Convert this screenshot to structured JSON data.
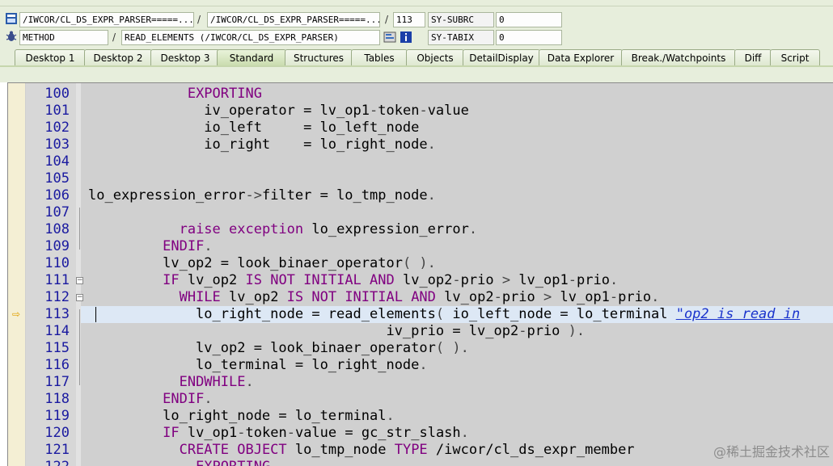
{
  "header": {
    "row1": {
      "program": "/IWCOR/CL_DS_EXPR_PARSER=====...",
      "include": "/IWCOR/CL_DS_EXPR_PARSER=====...",
      "line": "113",
      "sysfield": "SY-SUBRC",
      "sysvalue": "0",
      "separator": "/"
    },
    "row2": {
      "event_type": "METHOD",
      "event": "READ_ELEMENTS (/IWCOR/CL_DS_EXPR_PARSER)",
      "sysfield": "SY-TABIX",
      "sysvalue": "0",
      "separator": "/"
    }
  },
  "tabs": [
    {
      "label": "Desktop 1"
    },
    {
      "label": "Desktop 2"
    },
    {
      "label": "Desktop 3"
    },
    {
      "label": "Standard",
      "active": true
    },
    {
      "label": "Structures"
    },
    {
      "label": "Tables"
    },
    {
      "label": "Objects"
    },
    {
      "label": "DetailDisplay"
    },
    {
      "label": "Data Explorer"
    },
    {
      "label": "Break./Watchpoints"
    },
    {
      "label": "Diff"
    },
    {
      "label": "Script"
    }
  ],
  "code": {
    "current_line": "113",
    "lines": [
      {
        "n": "100",
        "segs": [
          [
            "            ",
            ""
          ],
          [
            "EXPORTING",
            "kw"
          ]
        ]
      },
      {
        "n": "101",
        "segs": [
          [
            "              iv_operator = lv_op1",
            ""
          ],
          [
            "-",
            "op"
          ],
          [
            "token",
            ""
          ],
          [
            "-",
            "op"
          ],
          [
            "value",
            ""
          ]
        ]
      },
      {
        "n": "102",
        "segs": [
          [
            "              io_left     = lo_left_node",
            ""
          ]
        ]
      },
      {
        "n": "103",
        "segs": [
          [
            "              io_right    = lo_right_node",
            ""
          ],
          [
            ".",
            "op"
          ]
        ]
      },
      {
        "n": "104",
        "segs": []
      },
      {
        "n": "105",
        "segs": []
      },
      {
        "n": "106",
        "segs": [
          [
            "lo_expression_error",
            ""
          ],
          [
            "->",
            "op"
          ],
          [
            "filter = lo_tmp_node",
            ""
          ],
          [
            ".",
            "op"
          ]
        ]
      },
      {
        "n": "107",
        "segs": []
      },
      {
        "n": "108",
        "segs": [
          [
            "           ",
            ""
          ],
          [
            "raise exception",
            "kw"
          ],
          [
            " lo_expression_error",
            ""
          ],
          [
            ".",
            "op"
          ]
        ]
      },
      {
        "n": "109",
        "segs": [
          [
            "         ",
            ""
          ],
          [
            "ENDIF",
            "kw"
          ],
          [
            ".",
            "op"
          ]
        ]
      },
      {
        "n": "110",
        "segs": [
          [
            "         lv_op2 = look_binaer_operator",
            ""
          ],
          [
            "( ).",
            "op"
          ]
        ]
      },
      {
        "n": "111",
        "segs": [
          [
            "         ",
            ""
          ],
          [
            "IF",
            "kw"
          ],
          [
            " lv_op2 ",
            ""
          ],
          [
            "IS NOT INITIAL AND",
            "kw"
          ],
          [
            " lv_op2",
            ""
          ],
          [
            "-",
            "op"
          ],
          [
            "prio ",
            ""
          ],
          [
            ">",
            "op"
          ],
          [
            " lv_op1",
            ""
          ],
          [
            "-",
            "op"
          ],
          [
            "prio",
            ""
          ],
          [
            ".",
            "op"
          ]
        ]
      },
      {
        "n": "112",
        "segs": [
          [
            "           ",
            ""
          ],
          [
            "WHILE",
            "kw"
          ],
          [
            " lv_op2 ",
            ""
          ],
          [
            "IS NOT INITIAL AND",
            "kw"
          ],
          [
            " lv_op2",
            ""
          ],
          [
            "-",
            "op"
          ],
          [
            "prio ",
            ""
          ],
          [
            ">",
            "op"
          ],
          [
            " lv_op1",
            ""
          ],
          [
            "-",
            "op"
          ],
          [
            "prio",
            ""
          ],
          [
            ".",
            "op"
          ]
        ]
      },
      {
        "n": "113",
        "segs": [
          [
            "             lo_right_node = read_elements",
            ""
          ],
          [
            "(",
            "op"
          ],
          [
            " io_left_node = lo_terminal ",
            ""
          ],
          [
            "\"op2 is read in",
            "cm"
          ]
        ]
      },
      {
        "n": "114",
        "segs": [
          [
            "                                    iv_prio = lv_op2",
            ""
          ],
          [
            "-",
            "op"
          ],
          [
            "prio ",
            ""
          ],
          [
            ").",
            "op"
          ]
        ]
      },
      {
        "n": "115",
        "segs": [
          [
            "             lv_op2 = look_binaer_operator",
            ""
          ],
          [
            "( ).",
            "op"
          ]
        ]
      },
      {
        "n": "116",
        "segs": [
          [
            "             lo_terminal = lo_right_node",
            ""
          ],
          [
            ".",
            "op"
          ]
        ]
      },
      {
        "n": "117",
        "segs": [
          [
            "           ",
            ""
          ],
          [
            "ENDWHILE",
            "kw"
          ],
          [
            ".",
            "op"
          ]
        ]
      },
      {
        "n": "118",
        "segs": [
          [
            "         ",
            ""
          ],
          [
            "ENDIF",
            "kw"
          ],
          [
            ".",
            "op"
          ]
        ]
      },
      {
        "n": "119",
        "segs": [
          [
            "         lo_right_node = lo_terminal",
            ""
          ],
          [
            ".",
            "op"
          ]
        ]
      },
      {
        "n": "120",
        "segs": [
          [
            "         ",
            ""
          ],
          [
            "IF",
            "kw"
          ],
          [
            " lv_op1",
            ""
          ],
          [
            "-",
            "op"
          ],
          [
            "token",
            ""
          ],
          [
            "-",
            "op"
          ],
          [
            "value = gc_str_slash",
            ""
          ],
          [
            ".",
            "op"
          ]
        ]
      },
      {
        "n": "121",
        "segs": [
          [
            "           ",
            ""
          ],
          [
            "CREATE OBJECT",
            "kw"
          ],
          [
            " lo_tmp_node ",
            ""
          ],
          [
            "TYPE",
            "kw"
          ],
          [
            " /iwcor/cl_ds_expr_member",
            ""
          ]
        ]
      },
      {
        "n": "122",
        "segs": [
          [
            "             ",
            ""
          ],
          [
            "EXPORTING",
            "kw"
          ]
        ]
      }
    ]
  },
  "watermark": "@稀土掘金技术社区",
  "colors": {
    "keyword": "#800080",
    "line_number": "#1a1aa0",
    "comment": "#1a33cc",
    "header_bg": "#e7eedc"
  }
}
